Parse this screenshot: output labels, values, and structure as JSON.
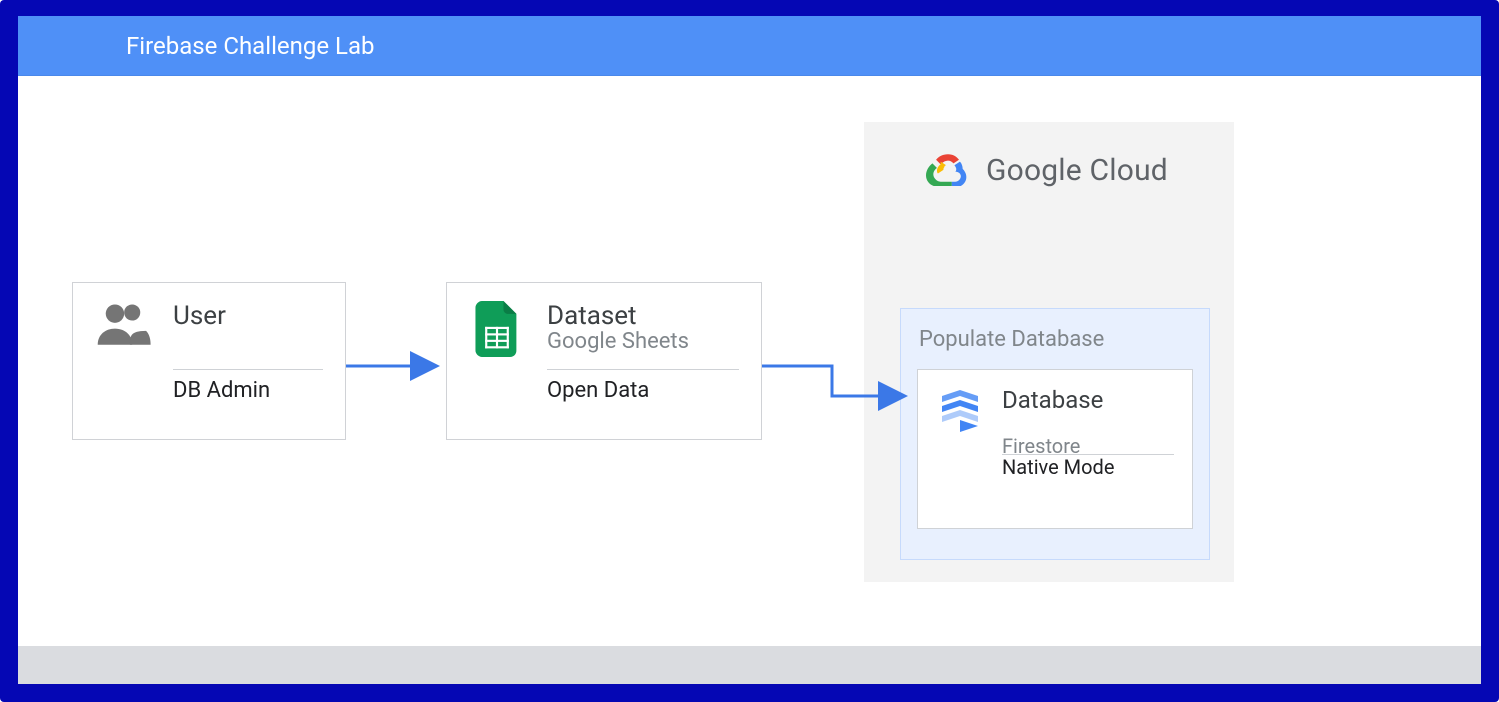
{
  "header": {
    "title": "Firebase Challenge Lab"
  },
  "nodes": {
    "user": {
      "title": "User",
      "subtitle": "",
      "note": "DB Admin"
    },
    "dataset": {
      "title": "Dataset",
      "subtitle": "Google Sheets",
      "note": "Open Data"
    },
    "cloud": {
      "label": "Google Cloud",
      "region": {
        "title": "Populate Database",
        "database": {
          "title": "Database",
          "subtitle": "Firestore",
          "note": "Native Mode"
        }
      }
    }
  },
  "icons": {
    "user": "users-icon",
    "dataset": "google-sheets-icon",
    "cloud": "google-cloud-icon",
    "database": "firestore-icon"
  },
  "colors": {
    "frame": "#0507b4",
    "header": "#4f90f7",
    "arrow": "#3b78e7",
    "cloudRegion": "#f3f3f3",
    "popRegion": "#e8f0fe"
  }
}
